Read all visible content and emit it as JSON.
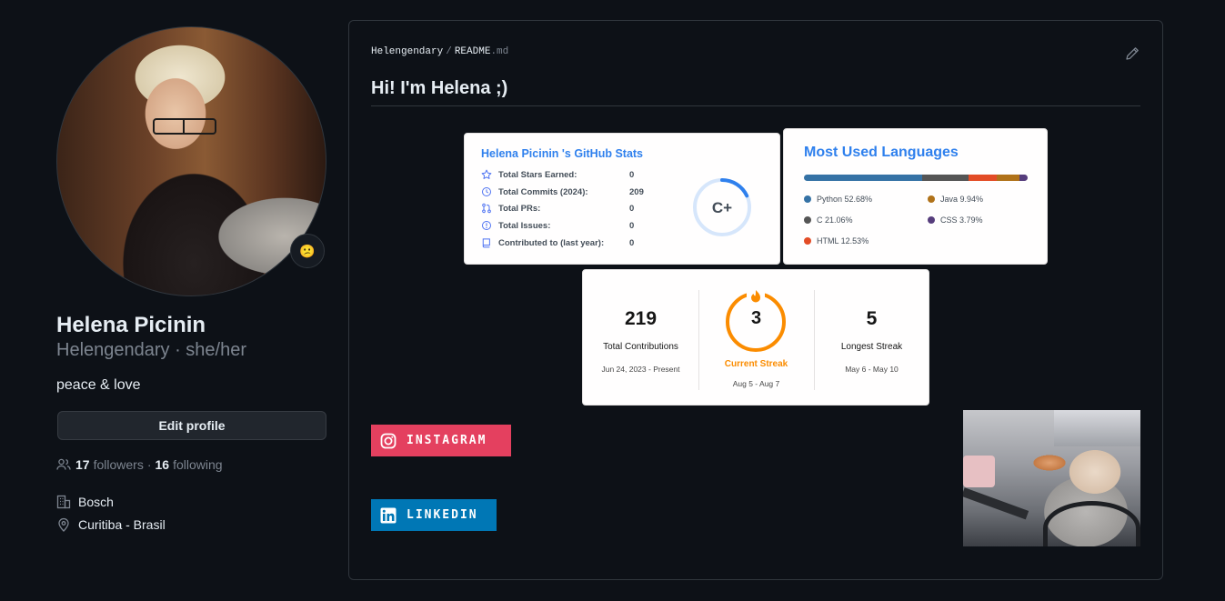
{
  "profile": {
    "name": "Helena Picinin",
    "login": "Helengendary",
    "pronouns": "she/her",
    "login_line": "Helengendary · she/her",
    "status_emoji": "😕",
    "bio": "peace & love",
    "edit_label": "Edit profile",
    "followers_count": "17",
    "followers_label": "followers",
    "following_count": "16",
    "following_label": "following",
    "company": "Bosch",
    "location": "Curitiba - Brasil"
  },
  "readme": {
    "owner": "Helengendary",
    "file_base": "README",
    "file_ext": ".md",
    "heading": "Hi! I'm Helena ;)"
  },
  "stats_card": {
    "title": "Helena Picinin 's GitHub Stats",
    "rows": [
      {
        "label": "Total Stars Earned:",
        "value": "0",
        "icon": "star-icon"
      },
      {
        "label": "Total Commits (2024):",
        "value": "209",
        "icon": "history-icon"
      },
      {
        "label": "Total PRs:",
        "value": "0",
        "icon": "pull-request-icon"
      },
      {
        "label": "Total Issues:",
        "value": "0",
        "icon": "issue-icon"
      },
      {
        "label": "Contributed to (last year):",
        "value": "0",
        "icon": "repo-icon"
      }
    ],
    "rank": "C+",
    "rank_progress": 0.18,
    "accent": "#2f80ed"
  },
  "languages_card": {
    "title": "Most Used Languages",
    "languages": [
      {
        "name": "Python",
        "percent": 52.68,
        "label": "Python 52.68%",
        "color": "#3572A5"
      },
      {
        "name": "C",
        "percent": 21.06,
        "label": "C 21.06%",
        "color": "#555555"
      },
      {
        "name": "HTML",
        "percent": 12.53,
        "label": "HTML 12.53%",
        "color": "#e34c26"
      },
      {
        "name": "Java",
        "percent": 9.94,
        "label": "Java 9.94%",
        "color": "#b07219"
      },
      {
        "name": "CSS",
        "percent": 3.79,
        "label": "CSS 3.79%",
        "color": "#563d7c"
      }
    ]
  },
  "streak_card": {
    "total": "219",
    "total_label": "Total Contributions",
    "total_range": "Jun 24, 2023 - Present",
    "current": "3",
    "current_label": "Current Streak",
    "current_range": "Aug 5 - Aug 7",
    "longest": "5",
    "longest_label": "Longest Streak",
    "longest_range": "May 6 - May 10",
    "accent": "#fb8c00"
  },
  "badges": {
    "instagram": "INSTAGRAM",
    "linkedin": "LINKEDIN"
  }
}
